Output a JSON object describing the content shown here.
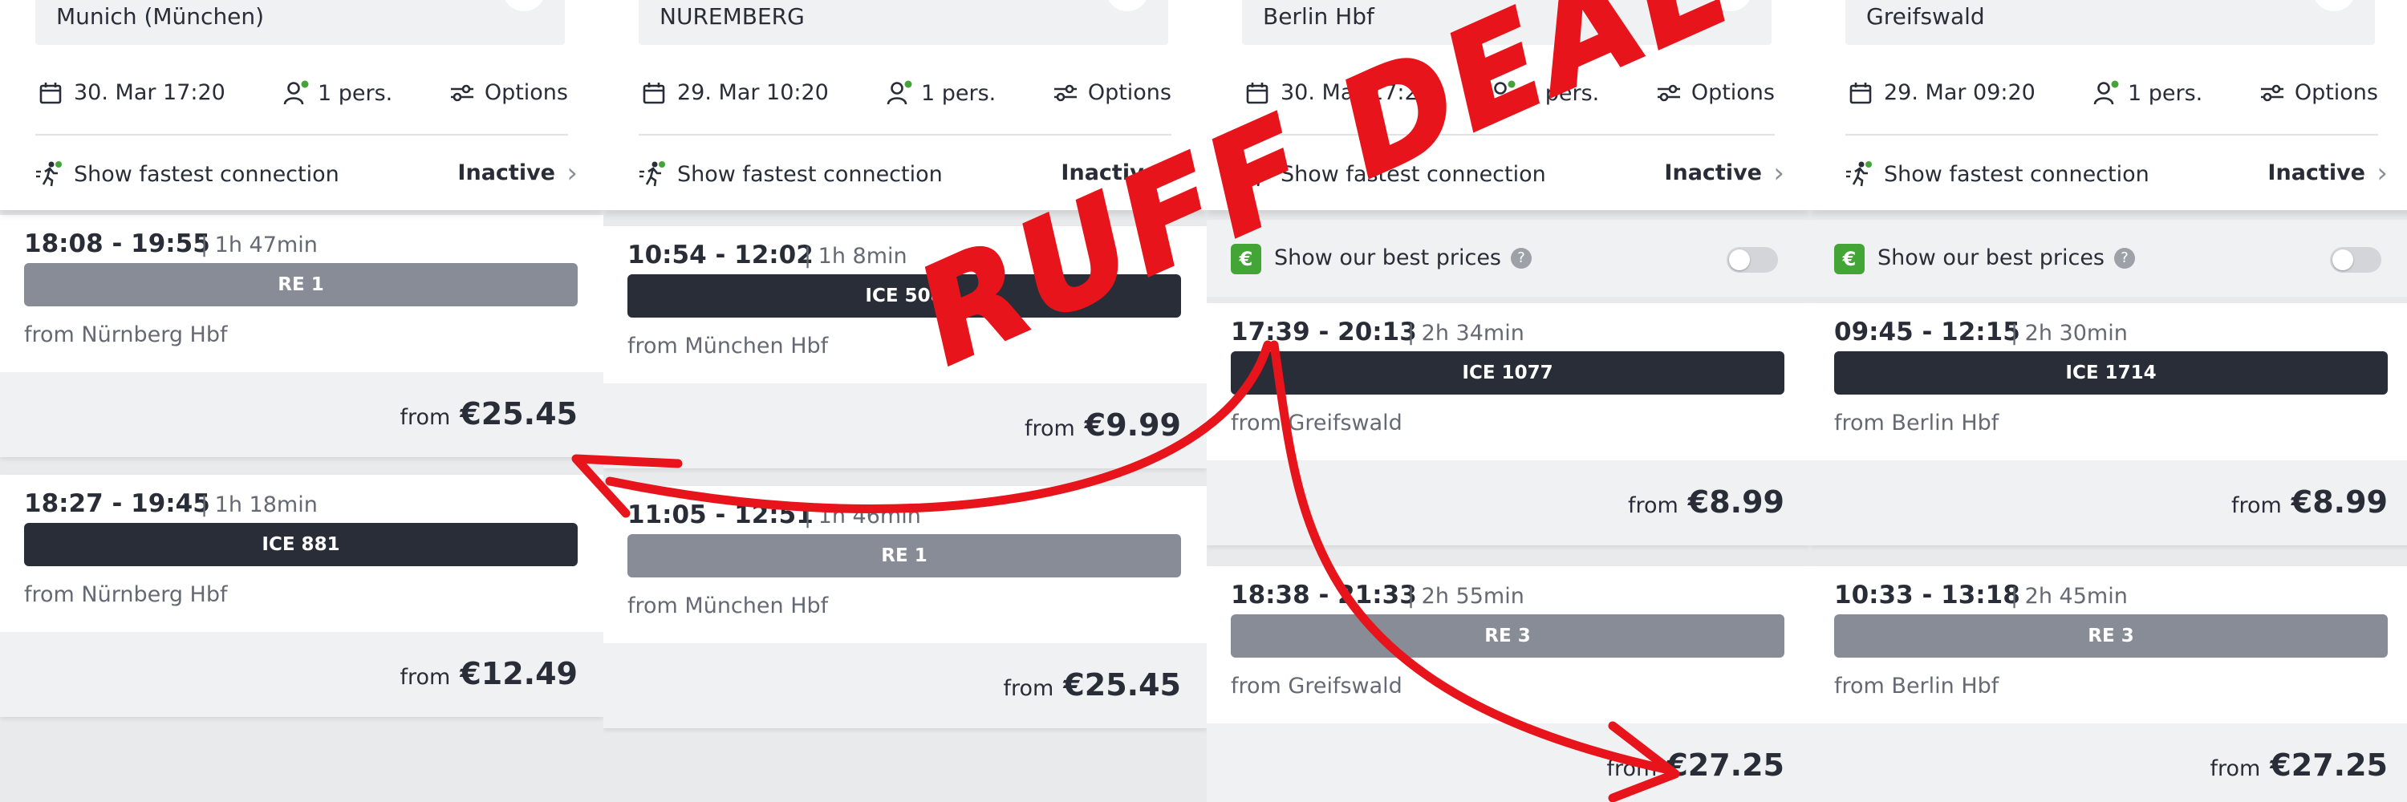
{
  "panels": [
    {
      "station": "Munich (München)",
      "date": "30. Mar 17:20",
      "persons": "1 pers.",
      "options": "Options",
      "fastest_label": "Show fastest connection",
      "fastest_state": "Inactive",
      "connections": [
        {
          "times": "18:08 - 19:55",
          "duration": "| 1h 47min",
          "train": "RE 1",
          "train_type": "re",
          "from_station": "from Nürnberg Hbf",
          "price_prefix": "from",
          "price": "€25.45"
        },
        {
          "times": "18:27 - 19:45",
          "duration": "| 1h 18min",
          "train": "ICE 881",
          "train_type": "ice",
          "from_station": "from Nürnberg Hbf",
          "price_prefix": "from",
          "price": "€12.49"
        }
      ]
    },
    {
      "station": "NUREMBERG",
      "date": "29. Mar 10:20",
      "persons": "1 pers.",
      "options": "Options",
      "fastest_label": "Show fastest connection",
      "fastest_state": "Inactive",
      "connections": [
        {
          "times": "10:54 - 12:02",
          "duration": "| 1h 8min",
          "train": "ICE 508",
          "train_type": "ice",
          "from_station": "from München Hbf",
          "price_prefix": "from",
          "price": "€9.99"
        },
        {
          "times": "11:05 - 12:51",
          "duration": "| 1h 46min",
          "train": "RE 1",
          "train_type": "re",
          "from_station": "from München Hbf",
          "price_prefix": "from",
          "price": "€25.45"
        }
      ]
    },
    {
      "station": "Berlin Hbf",
      "date": "30. Mar 17:20",
      "persons": "1 pers.",
      "options": "Options",
      "fastest_label": "Show fastest connection",
      "fastest_state": "Inactive",
      "best_prices_label": "Show our best prices",
      "connections": [
        {
          "times": "17:39 - 20:13",
          "duration": "| 2h 34min",
          "train": "ICE 1077",
          "train_type": "ice",
          "from_station": "from Greifswald",
          "price_prefix": "from",
          "price": "€8.99"
        },
        {
          "times": "18:38 - 21:33",
          "duration": "| 2h 55min",
          "train": "RE 3",
          "train_type": "re",
          "from_station": "from Greifswald",
          "price_prefix": "from",
          "price": "€27.25"
        }
      ]
    },
    {
      "station": "Greifswald",
      "date": "29. Mar 09:20",
      "persons": "1 pers.",
      "options": "Options",
      "fastest_label": "Show fastest connection",
      "fastest_state": "Inactive",
      "best_prices_label": "Show our best prices",
      "connections": [
        {
          "times": "09:45 - 12:15",
          "duration": "| 2h 30min",
          "train": "ICE 1714",
          "train_type": "ice",
          "from_station": "from Berlin Hbf",
          "price_prefix": "from",
          "price": "€8.99"
        },
        {
          "times": "10:33 - 13:18",
          "duration": "| 2h 45min",
          "train": "RE 3",
          "train_type": "re",
          "from_station": "from Berlin Hbf",
          "price_prefix": "from",
          "price": "€27.25"
        }
      ]
    }
  ],
  "annotation": {
    "text": "RUFF DEAL",
    "color": "#e8141b"
  },
  "icons": {
    "calendar": "calendar-icon",
    "person": "person-icon",
    "options": "sliders-icon",
    "runner": "running-person-icon",
    "chevron": "chevron-right-icon",
    "best_price": "c-badge-icon",
    "help": "help-icon"
  }
}
